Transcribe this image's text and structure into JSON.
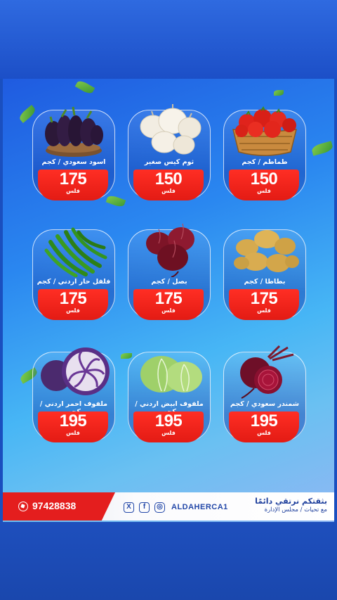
{
  "products": [
    {
      "name": "طماطم / كجم",
      "price": "150",
      "unit": "فلس",
      "icon": "tomato-basket"
    },
    {
      "name": "ثوم كيس صغير",
      "price": "150",
      "unit": "فلس",
      "icon": "garlic"
    },
    {
      "name": "اسود سعودي / كجم",
      "price": "175",
      "unit": "فلس",
      "icon": "eggplant"
    },
    {
      "name": "بطاطا / كجم",
      "price": "175",
      "unit": "فلس",
      "icon": "potato"
    },
    {
      "name": "بصل / كجم",
      "price": "175",
      "unit": "فلس",
      "icon": "red-onion"
    },
    {
      "name": "فلفل حار اردني / كجم",
      "price": "175",
      "unit": "فلس",
      "icon": "green-chili"
    },
    {
      "name": "شمندر سعودي / كجم",
      "price": "195",
      "unit": "فلس",
      "icon": "beetroot"
    },
    {
      "name": "ملفوف ابيض اردني / كجم",
      "price": "195",
      "unit": "فلس",
      "icon": "green-cabbage"
    },
    {
      "name": "ملفوف احمر اردني / كجم",
      "price": "195",
      "unit": "فلس",
      "icon": "red-cabbage"
    }
  ],
  "footer": {
    "phone": "97428838",
    "handle": "ALDAHERCA1",
    "slogan_line1": "بثقتكم نرتقي دائمًا",
    "slogan_line2": "مع تحيات / مجلس الإدارة",
    "social_icons": [
      "x-icon",
      "facebook-icon",
      "instagram-icon"
    ]
  },
  "colors": {
    "price_red": "#e41e1e",
    "brand_blue": "#1e3f9c"
  }
}
